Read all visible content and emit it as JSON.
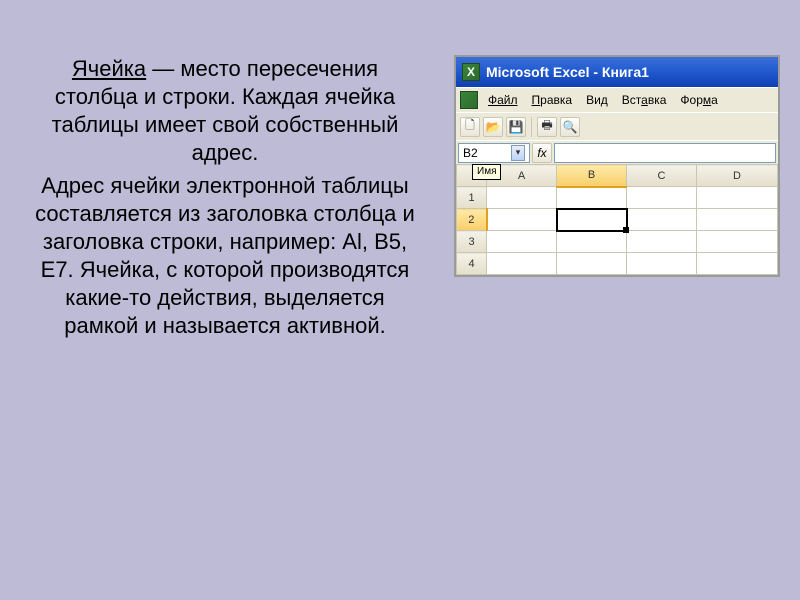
{
  "text": {
    "term": "Ячейка",
    "para1_rest": " — место пересечения столбца и строки. Каждая ячейка таблицы имеет свой собственный адрес.",
    "para2": "Адрес ячейки электронной таблицы составляется из заголовка столбца и заголовка строки, например: Al, B5, E7. Ячейка, с которой производятся какие-то действия, выделяется рамкой и называется активной."
  },
  "excel": {
    "title": "Microsoft Excel - Книга1",
    "menus": [
      "Файл",
      "Правка",
      "Вид",
      "Вставка",
      "Форма"
    ],
    "name_box": "B2",
    "name_hint": "Имя",
    "fx_label": "fx",
    "columns": [
      "A",
      "B",
      "C",
      "D"
    ],
    "rows": [
      "1",
      "2",
      "3",
      "4"
    ],
    "active_cell": {
      "col": "B",
      "row": "2"
    }
  }
}
